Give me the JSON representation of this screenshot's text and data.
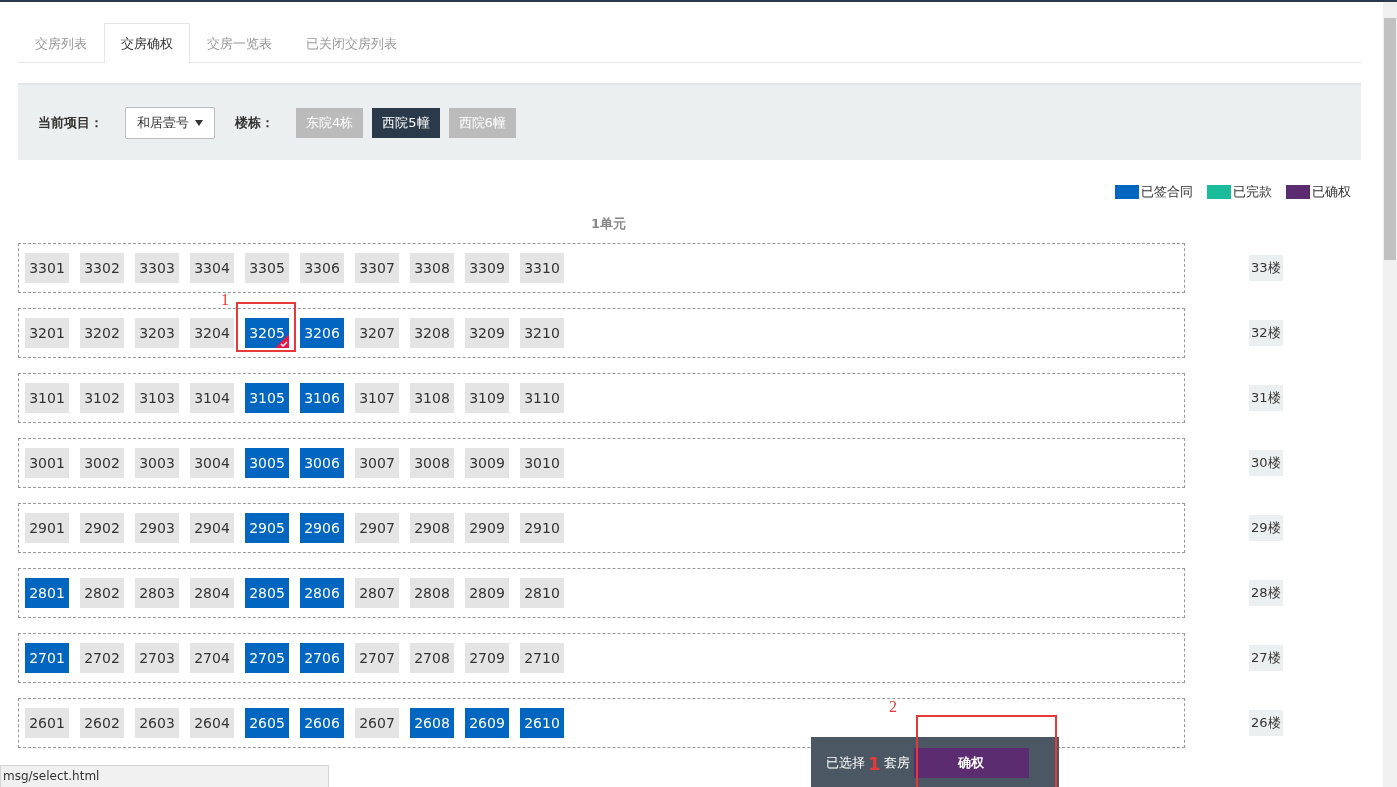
{
  "tabs": [
    {
      "label": "交房列表",
      "selected": false
    },
    {
      "label": "交房确权",
      "selected": true
    },
    {
      "label": "交房一览表",
      "selected": false
    },
    {
      "label": "已关闭交房列表",
      "selected": false
    }
  ],
  "filter": {
    "project_label": "当前项目：",
    "project_value": "和居壹号",
    "building_label": "楼栋：",
    "buildings": [
      {
        "label": "东院4栋",
        "selected": false
      },
      {
        "label": "西院5幢",
        "selected": true
      },
      {
        "label": "西院6幢",
        "selected": false
      }
    ]
  },
  "legend": [
    {
      "label": "已签合同",
      "color": "#0066c0"
    },
    {
      "label": "已完款",
      "color": "#1abc9c"
    },
    {
      "label": "已确权",
      "color": "#5b2c6f"
    }
  ],
  "unit_title": "1单元",
  "floors": [
    {
      "floor": "33楼",
      "units": [
        {
          "no": "3301",
          "signed": false,
          "selected": false
        },
        {
          "no": "3302",
          "signed": false,
          "selected": false
        },
        {
          "no": "3303",
          "signed": false,
          "selected": false
        },
        {
          "no": "3304",
          "signed": false,
          "selected": false
        },
        {
          "no": "3305",
          "signed": false,
          "selected": false
        },
        {
          "no": "3306",
          "signed": false,
          "selected": false
        },
        {
          "no": "3307",
          "signed": false,
          "selected": false
        },
        {
          "no": "3308",
          "signed": false,
          "selected": false
        },
        {
          "no": "3309",
          "signed": false,
          "selected": false
        },
        {
          "no": "3310",
          "signed": false,
          "selected": false
        }
      ]
    },
    {
      "floor": "32楼",
      "units": [
        {
          "no": "3201",
          "signed": false,
          "selected": false
        },
        {
          "no": "3202",
          "signed": false,
          "selected": false
        },
        {
          "no": "3203",
          "signed": false,
          "selected": false
        },
        {
          "no": "3204",
          "signed": false,
          "selected": false
        },
        {
          "no": "3205",
          "signed": true,
          "selected": true,
          "annotation": "1"
        },
        {
          "no": "3206",
          "signed": true,
          "selected": false
        },
        {
          "no": "3207",
          "signed": false,
          "selected": false
        },
        {
          "no": "3208",
          "signed": false,
          "selected": false
        },
        {
          "no": "3209",
          "signed": false,
          "selected": false
        },
        {
          "no": "3210",
          "signed": false,
          "selected": false
        }
      ]
    },
    {
      "floor": "31楼",
      "units": [
        {
          "no": "3101",
          "signed": false,
          "selected": false
        },
        {
          "no": "3102",
          "signed": false,
          "selected": false
        },
        {
          "no": "3103",
          "signed": false,
          "selected": false
        },
        {
          "no": "3104",
          "signed": false,
          "selected": false
        },
        {
          "no": "3105",
          "signed": true,
          "selected": false
        },
        {
          "no": "3106",
          "signed": true,
          "selected": false
        },
        {
          "no": "3107",
          "signed": false,
          "selected": false
        },
        {
          "no": "3108",
          "signed": false,
          "selected": false
        },
        {
          "no": "3109",
          "signed": false,
          "selected": false
        },
        {
          "no": "3110",
          "signed": false,
          "selected": false
        }
      ]
    },
    {
      "floor": "30楼",
      "units": [
        {
          "no": "3001",
          "signed": false,
          "selected": false
        },
        {
          "no": "3002",
          "signed": false,
          "selected": false
        },
        {
          "no": "3003",
          "signed": false,
          "selected": false
        },
        {
          "no": "3004",
          "signed": false,
          "selected": false
        },
        {
          "no": "3005",
          "signed": true,
          "selected": false
        },
        {
          "no": "3006",
          "signed": true,
          "selected": false
        },
        {
          "no": "3007",
          "signed": false,
          "selected": false
        },
        {
          "no": "3008",
          "signed": false,
          "selected": false
        },
        {
          "no": "3009",
          "signed": false,
          "selected": false
        },
        {
          "no": "3010",
          "signed": false,
          "selected": false
        }
      ]
    },
    {
      "floor": "29楼",
      "units": [
        {
          "no": "2901",
          "signed": false,
          "selected": false
        },
        {
          "no": "2902",
          "signed": false,
          "selected": false
        },
        {
          "no": "2903",
          "signed": false,
          "selected": false
        },
        {
          "no": "2904",
          "signed": false,
          "selected": false
        },
        {
          "no": "2905",
          "signed": true,
          "selected": false
        },
        {
          "no": "2906",
          "signed": true,
          "selected": false
        },
        {
          "no": "2907",
          "signed": false,
          "selected": false
        },
        {
          "no": "2908",
          "signed": false,
          "selected": false
        },
        {
          "no": "2909",
          "signed": false,
          "selected": false
        },
        {
          "no": "2910",
          "signed": false,
          "selected": false
        }
      ]
    },
    {
      "floor": "28楼",
      "units": [
        {
          "no": "2801",
          "signed": true,
          "selected": false
        },
        {
          "no": "2802",
          "signed": false,
          "selected": false
        },
        {
          "no": "2803",
          "signed": false,
          "selected": false
        },
        {
          "no": "2804",
          "signed": false,
          "selected": false
        },
        {
          "no": "2805",
          "signed": true,
          "selected": false
        },
        {
          "no": "2806",
          "signed": true,
          "selected": false
        },
        {
          "no": "2807",
          "signed": false,
          "selected": false
        },
        {
          "no": "2808",
          "signed": false,
          "selected": false
        },
        {
          "no": "2809",
          "signed": false,
          "selected": false
        },
        {
          "no": "2810",
          "signed": false,
          "selected": false
        }
      ]
    },
    {
      "floor": "27楼",
      "units": [
        {
          "no": "2701",
          "signed": true,
          "selected": false
        },
        {
          "no": "2702",
          "signed": false,
          "selected": false
        },
        {
          "no": "2703",
          "signed": false,
          "selected": false
        },
        {
          "no": "2704",
          "signed": false,
          "selected": false
        },
        {
          "no": "2705",
          "signed": true,
          "selected": false
        },
        {
          "no": "2706",
          "signed": true,
          "selected": false
        },
        {
          "no": "2707",
          "signed": false,
          "selected": false
        },
        {
          "no": "2708",
          "signed": false,
          "selected": false
        },
        {
          "no": "2709",
          "signed": false,
          "selected": false
        },
        {
          "no": "2710",
          "signed": false,
          "selected": false
        }
      ]
    },
    {
      "floor": "26楼",
      "units": [
        {
          "no": "2601",
          "signed": false,
          "selected": false
        },
        {
          "no": "2602",
          "signed": false,
          "selected": false
        },
        {
          "no": "2603",
          "signed": false,
          "selected": false
        },
        {
          "no": "2604",
          "signed": false,
          "selected": false
        },
        {
          "no": "2605",
          "signed": true,
          "selected": false
        },
        {
          "no": "2606",
          "signed": true,
          "selected": false
        },
        {
          "no": "2607",
          "signed": false,
          "selected": false
        },
        {
          "no": "2608",
          "signed": true,
          "selected": false
        },
        {
          "no": "2609",
          "signed": true,
          "selected": false
        },
        {
          "no": "2610",
          "signed": true,
          "selected": false
        }
      ]
    }
  ],
  "selection_bar": {
    "prefix": "已选择",
    "count": "1",
    "suffix": "套房",
    "button": "确权",
    "annotation": "2"
  },
  "status_bar": "msg/select.html"
}
